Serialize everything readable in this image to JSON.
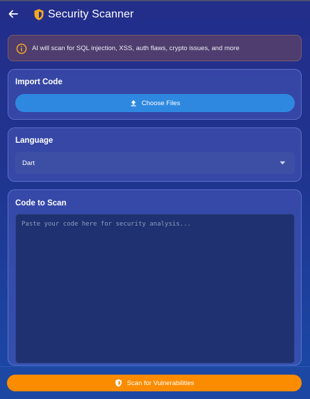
{
  "appbar": {
    "title": "Security Scanner",
    "back_icon": "arrow-left-icon",
    "title_icon": "security-shield-icon"
  },
  "info_banner": {
    "icon": "info-icon",
    "text": "AI will scan for SQL injection, XSS, auth flaws, crypto issues, and more"
  },
  "import_card": {
    "title": "Import Code",
    "button_label": "Choose Files",
    "button_icon": "upload-icon"
  },
  "language_card": {
    "title": "Language",
    "selected": "Dart",
    "dropdown_icon": "dropdown-arrow-icon"
  },
  "code_card": {
    "title": "Code to Scan",
    "placeholder": "Paste your code here for security analysis...",
    "value": ""
  },
  "scan_button": {
    "label": "Scan for Vulnerabilities",
    "icon": "security-shield-icon"
  },
  "colors": {
    "accent_orange": "#fb8c00",
    "button_blue": "#2e88e0",
    "warning_icon": "#f5a623"
  }
}
